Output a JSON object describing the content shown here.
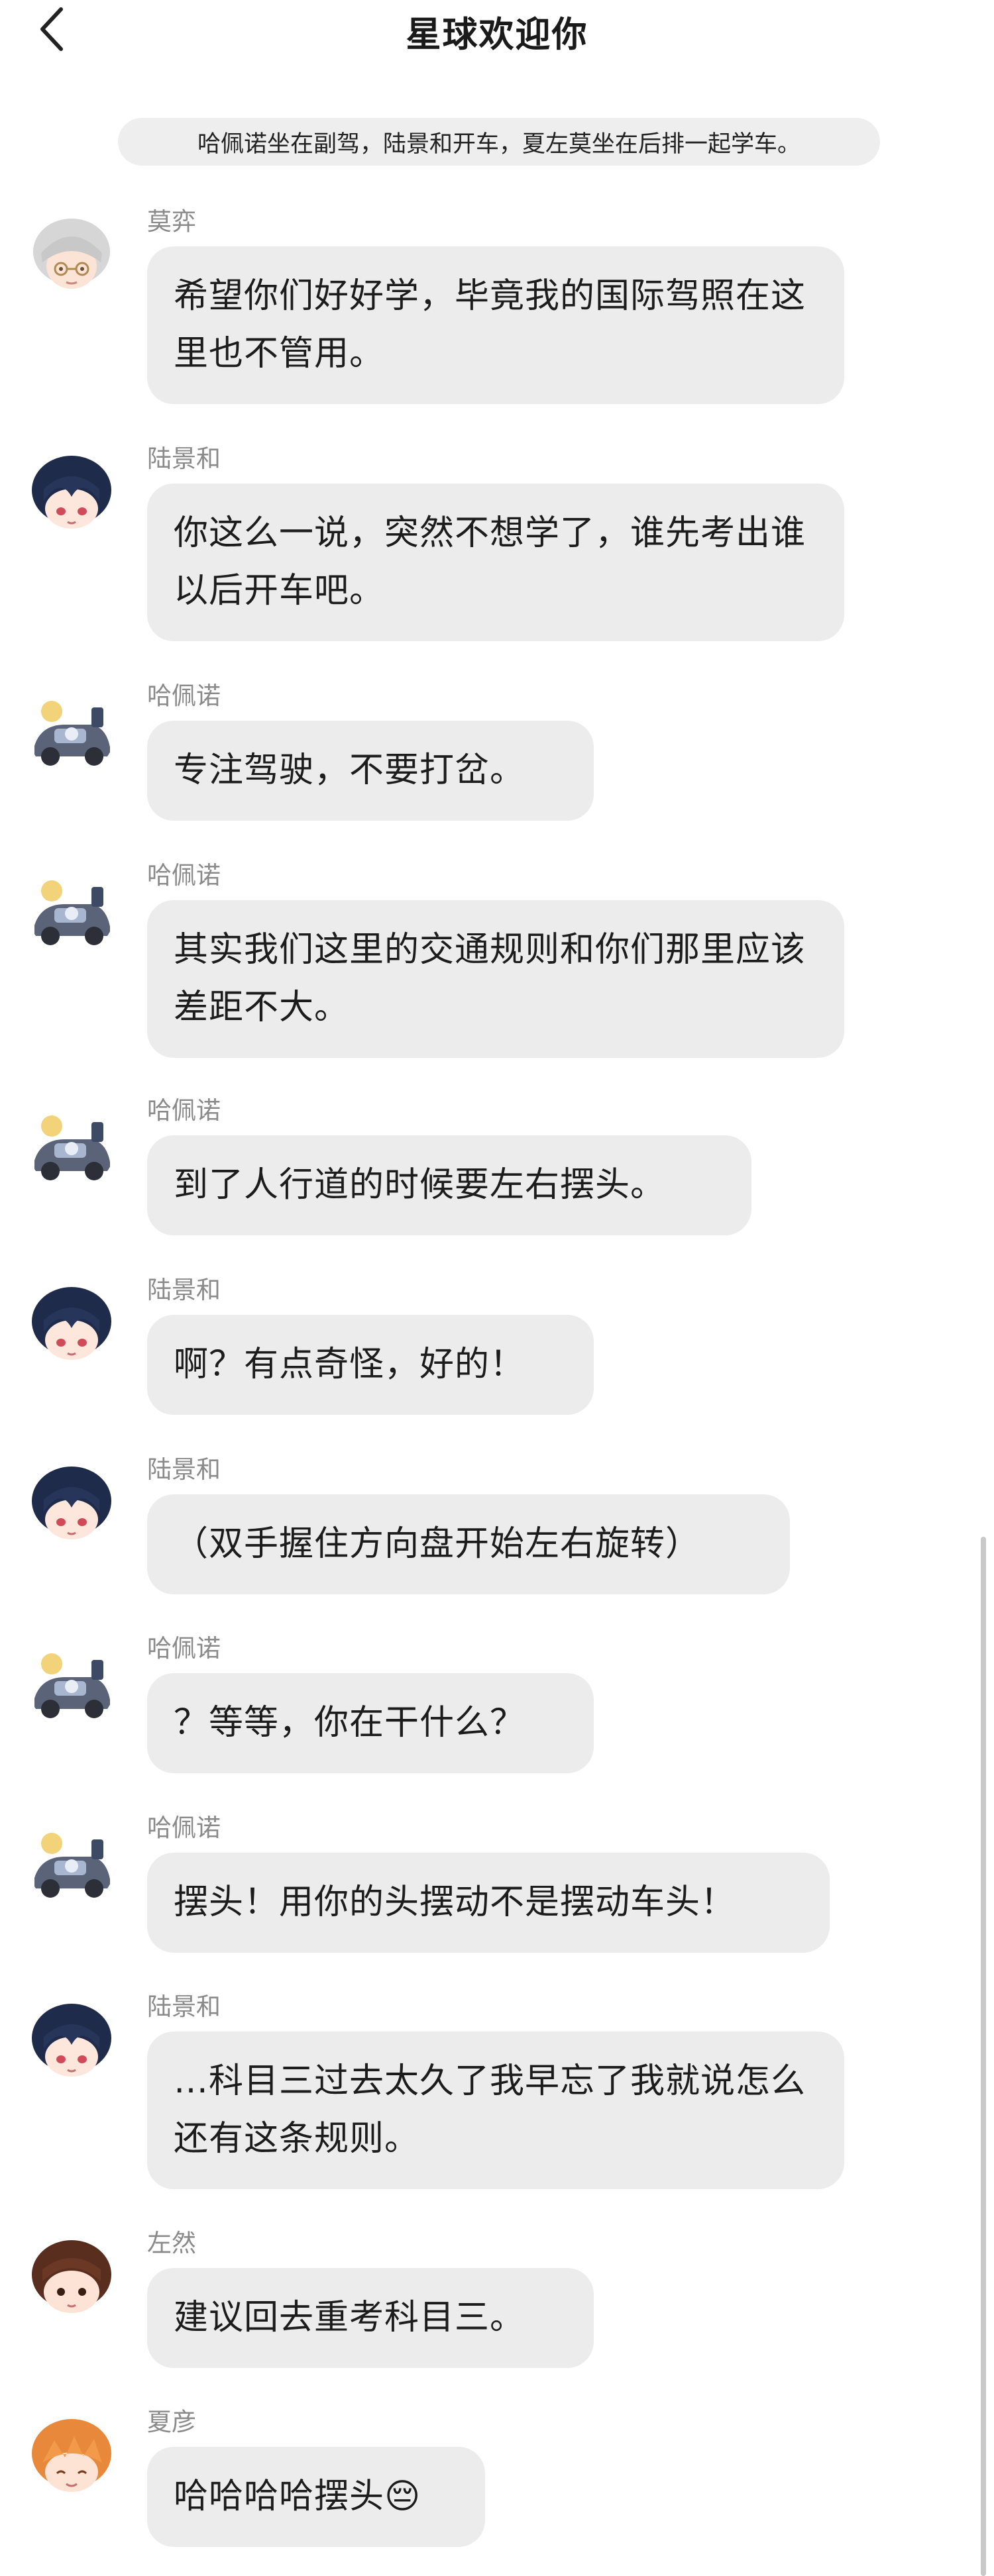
{
  "header": {
    "title": "星球欢迎你"
  },
  "notice": "哈佩诺坐在副驾，陆景和开车，夏左莫坐在后排一起学车。",
  "messages": [
    {
      "sender": "莫弈",
      "text": "希望你们好好学，毕竟我的国际驾照在这里也不管用。",
      "avatar": "moyi"
    },
    {
      "sender": "陆景和",
      "text": "你这么一说，突然不想学了，谁先考出谁以后开车吧。",
      "avatar": "lujinghe"
    },
    {
      "sender": "哈佩诺",
      "text": "专注驾驶，不要打岔。",
      "avatar": "hapeinuo"
    },
    {
      "sender": "哈佩诺",
      "text": "其实我们这里的交通规则和你们那里应该差距不大。",
      "avatar": "hapeinuo"
    },
    {
      "sender": "哈佩诺",
      "text": "到了人行道的时候要左右摆头。",
      "avatar": "hapeinuo"
    },
    {
      "sender": "陆景和",
      "text": "啊？有点奇怪，好的！",
      "avatar": "lujinghe"
    },
    {
      "sender": "陆景和",
      "text": "（双手握住方向盘开始左右旋转）",
      "avatar": "lujinghe"
    },
    {
      "sender": "哈佩诺",
      "text": "？等等，你在干什么？",
      "avatar": "hapeinuo"
    },
    {
      "sender": "哈佩诺",
      "text": "摆头！用你的头摆动不是摆动车头！",
      "avatar": "hapeinuo"
    },
    {
      "sender": "陆景和",
      "text": "…科目三过去太久了我早忘了我就说怎么还有这条规则。",
      "avatar": "lujinghe"
    },
    {
      "sender": "左然",
      "text": "建议回去重考科目三。",
      "avatar": "zuoran"
    },
    {
      "sender": "夏彦",
      "text": "哈哈哈哈摆头😔",
      "avatar": "xiayan"
    }
  ],
  "icons": {
    "back": "chevron-left-icon"
  },
  "colors": {
    "bubble": "#ececec",
    "sender": "#8a8a8a",
    "notice": "#eeeeee"
  }
}
